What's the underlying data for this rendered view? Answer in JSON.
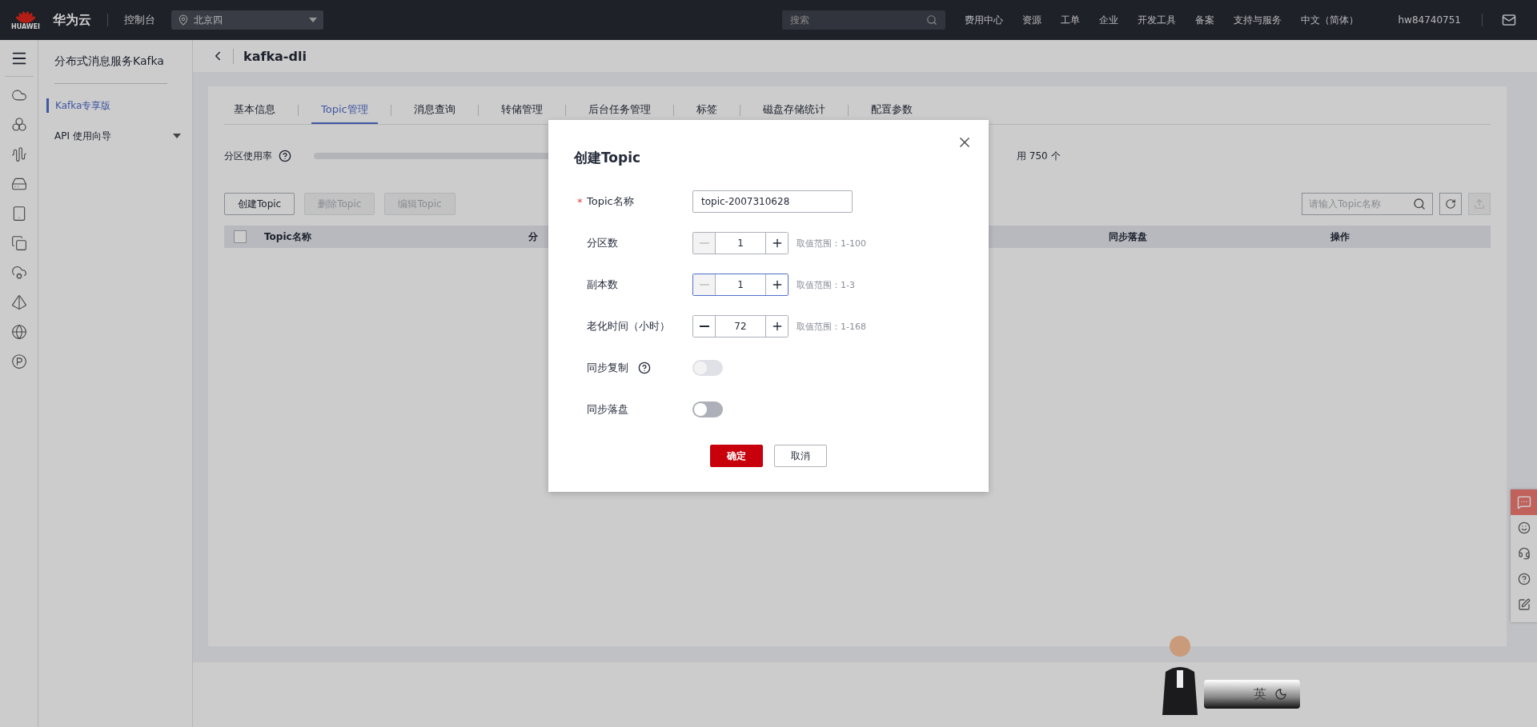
{
  "topbar": {
    "logo_caption": "HUAWEI",
    "brand": "华为云",
    "console": "控制台",
    "region": "北京四",
    "search_placeholder": "搜索",
    "links": [
      "费用中心",
      "资源",
      "工单",
      "企业",
      "开发工具",
      "备案",
      "支持与服务",
      "中文（简体）"
    ],
    "user": "hw84740751"
  },
  "sidebar": {
    "title": "分布式消息服务Kafka",
    "items": [
      {
        "label": "Kafka专享版",
        "selected": true,
        "kind": "link"
      },
      {
        "label": "API 使用向导",
        "selected": false,
        "kind": "group"
      }
    ]
  },
  "header": {
    "title": "kafka-dli"
  },
  "tabs": [
    {
      "label": "基本信息",
      "selected": false
    },
    {
      "label": "Topic管理",
      "selected": true
    },
    {
      "label": "消息查询",
      "selected": false
    },
    {
      "label": "转储管理",
      "selected": false
    },
    {
      "label": "后台任务管理",
      "selected": false
    },
    {
      "label": "标签",
      "selected": false
    },
    {
      "label": "磁盘存储统计",
      "selected": false
    },
    {
      "label": "配置参数",
      "selected": false
    }
  ],
  "usage": {
    "label": "分区使用率",
    "summary": "用 750 个"
  },
  "toolbar": {
    "buttons": [
      {
        "label": "创建Topic",
        "disabled": false
      },
      {
        "label": "删除Topic",
        "disabled": true
      },
      {
        "label": "编辑Topic",
        "disabled": true
      }
    ],
    "search_placeholder": "请输入Topic名称"
  },
  "table": {
    "select_all": false,
    "columns": [
      "Topic名称",
      "分",
      "同步落盘",
      "操作"
    ]
  },
  "dialog": {
    "title": "创建Topic",
    "required_mark": "*",
    "fields": [
      {
        "kind": "text",
        "label": "Topic名称",
        "required": true,
        "value": "topic-2007310628"
      },
      {
        "kind": "stepper",
        "label": "分区数",
        "required": false,
        "value": "1",
        "hint": "取值范围：1-100",
        "decrement_disabled": true,
        "focused": false
      },
      {
        "kind": "stepper",
        "label": "副本数",
        "required": false,
        "value": "1",
        "hint": "取值范围：1-3",
        "decrement_disabled": true,
        "focused": true
      },
      {
        "kind": "stepper",
        "label": "老化时间（小时）",
        "required": false,
        "value": "72",
        "hint": "取值范围：1-168",
        "decrement_disabled": false,
        "focused": false
      },
      {
        "kind": "switch",
        "label": "同步复制",
        "required": false,
        "on": false,
        "disabled": true,
        "help": true
      },
      {
        "kind": "switch",
        "label": "同步落盘",
        "required": false,
        "on": false,
        "disabled": false,
        "help": false
      }
    ],
    "buttons": [
      {
        "label": "确定",
        "primary": true
      },
      {
        "label": "取消",
        "primary": false
      }
    ]
  },
  "ime": {
    "label": "英"
  }
}
